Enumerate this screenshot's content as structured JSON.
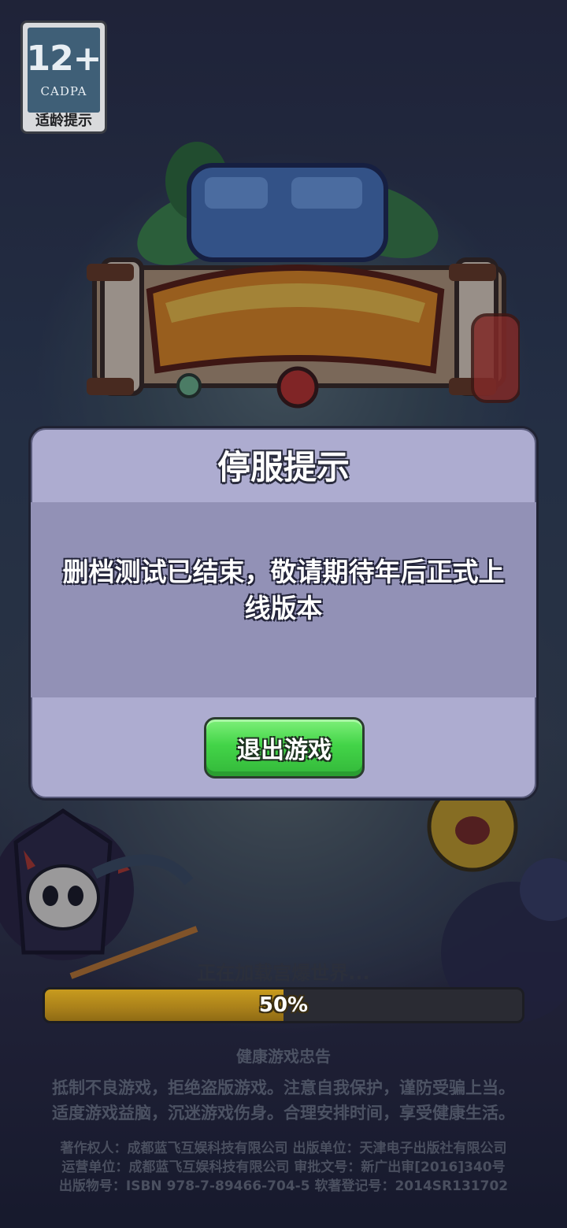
{
  "age_rating": {
    "number": "12+",
    "org": "CADPA",
    "tip": "适龄提示"
  },
  "dialog": {
    "title": "停服提示",
    "message": "删档测试已结束，敬请期待年后正式上线版本",
    "exit_button": "退出游戏"
  },
  "loading": {
    "text": "正在加载宫爆世界...",
    "percent": 50,
    "label": "50%"
  },
  "health_advice": {
    "title": "健康游戏忠告",
    "lines": [
      "抵制不良游戏，拒绝盗版游戏。注意自我保护，谨防受骗上当。",
      "适度游戏益脑，沉迷游戏伤身。合理安排时间，享受健康生活。"
    ]
  },
  "credits": [
    "著作权人：成都蓝飞互娱科技有限公司  出版单位：天津电子出版社有限公司",
    "运营单位：成都蓝飞互娱科技有限公司  审批文号：新广出审[2016]340号",
    "出版物号：ISBN 978-7-89466-704-5  软著登记号：2014SR131702"
  ],
  "colors": {
    "dialog_bg": "#adacd0",
    "dialog_body": "#9291b6",
    "button_green": "#43d448",
    "progress_gold": "#c89b1e"
  }
}
